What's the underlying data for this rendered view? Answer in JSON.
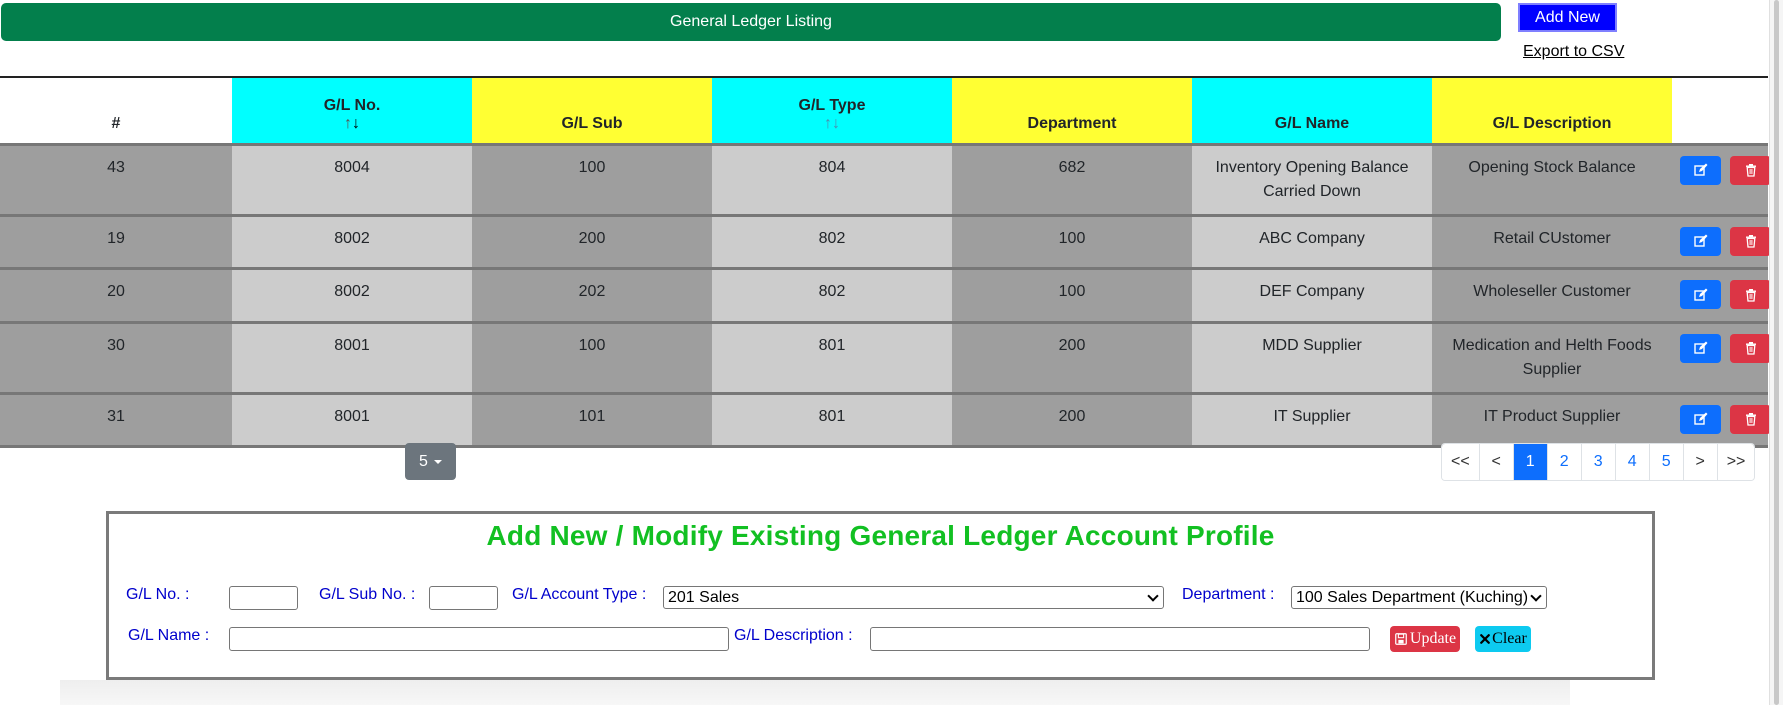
{
  "header": {
    "title": "General Ledger Listing",
    "add_new_label": "Add New",
    "export_label": "Export to CSV"
  },
  "table": {
    "columns": {
      "index": "#",
      "gl_no": "G/L No.",
      "gl_sub": "G/L Sub",
      "gl_type": "G/L Type",
      "department": "Department",
      "gl_name": "G/L Name",
      "gl_description": "G/L Description"
    },
    "sort_arrows": "↑↓",
    "rows": [
      {
        "index": "43",
        "gl_no": "8004",
        "gl_sub": "100",
        "gl_type": "804",
        "department": "682",
        "gl_name": "Inventory Opening Balance Carried Down",
        "gl_description": "Opening Stock Balance"
      },
      {
        "index": "19",
        "gl_no": "8002",
        "gl_sub": "200",
        "gl_type": "802",
        "department": "100",
        "gl_name": "ABC Company",
        "gl_description": "Retail CUstomer"
      },
      {
        "index": "20",
        "gl_no": "8002",
        "gl_sub": "202",
        "gl_type": "802",
        "department": "100",
        "gl_name": "DEF Company",
        "gl_description": "Wholeseller Customer"
      },
      {
        "index": "30",
        "gl_no": "8001",
        "gl_sub": "100",
        "gl_type": "801",
        "department": "200",
        "gl_name": "MDD Supplier",
        "gl_description": "Medication and Helth Foods Supplier"
      },
      {
        "index": "31",
        "gl_no": "8001",
        "gl_sub": "101",
        "gl_type": "801",
        "department": "200",
        "gl_name": "IT Supplier",
        "gl_description": "IT Product Supplier"
      }
    ]
  },
  "pager": {
    "page_size": "5",
    "items": [
      "<<",
      "<",
      "1",
      "2",
      "3",
      "4",
      "5",
      ">",
      ">>"
    ],
    "active": "1"
  },
  "form": {
    "title": "Add New / Modify Existing General Ledger Account Profile",
    "gl_no_label": "G/L No. :",
    "gl_no_value": "",
    "gl_sub_label": "G/L Sub No. :",
    "gl_sub_value": "",
    "gl_type_label": "G/L Account Type :",
    "gl_type_selected": "201 Sales",
    "department_label": "Department :",
    "department_selected": "100 Sales Department (Kuching)",
    "gl_name_label": "G/L Name :",
    "gl_name_value": "",
    "gl_desc_label": "G/L Description :",
    "gl_desc_value": "",
    "update_label": "Update",
    "clear_label": "Clear"
  },
  "colors": {
    "title_bar": "#037f4c",
    "header_cyan": "#00ffff",
    "header_yellow": "#ffff33",
    "edit_button": "#0d6efd",
    "delete_button": "#dc3545",
    "form_title": "#12c022",
    "form_label": "#0000cc"
  }
}
